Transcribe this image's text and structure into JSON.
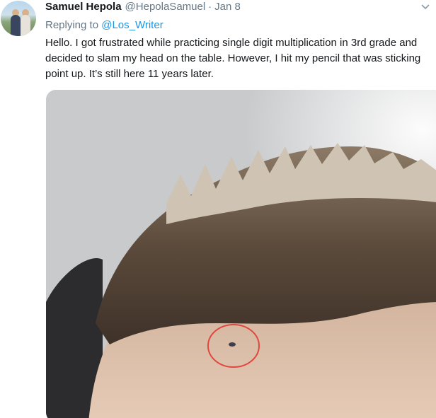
{
  "tweet": {
    "author": {
      "name": "Samuel Hepola",
      "handle": "@HepolaSamuel",
      "separator": "·",
      "date": "Jan 8",
      "avatar_icon": "profile-photo"
    },
    "reply": {
      "prefix": "Replying to ",
      "mention": "@Los_Writer"
    },
    "text_lines": [
      "Hello. I got frustrated while practicing single digit multiplication in 3rd grade and",
      "decided to slam my head on the table. However, I hit my pencil that was sticking",
      "point up. It’s still here 11 years later."
    ],
    "menu_icon": "chevron-down-icon",
    "media": {
      "description_icon": "photo",
      "highlight_color": "#e0483f"
    }
  }
}
